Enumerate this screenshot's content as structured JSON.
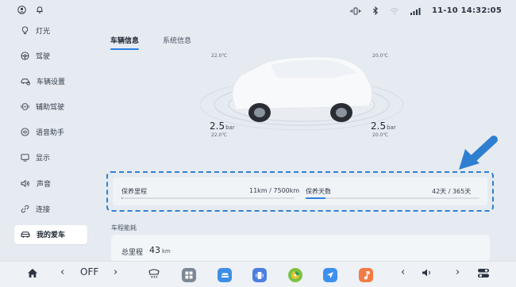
{
  "status_bar": {
    "datetime": "11-10 14:32:05",
    "left_icons": [
      "profile-icon",
      "bell-icon"
    ],
    "right_icons": [
      "vibrate-icon",
      "bluetooth-icon",
      "wifi-icon",
      "signal-icon"
    ]
  },
  "sidebar": {
    "items": [
      {
        "label": "灯光",
        "icon": "bulb-icon",
        "active": false
      },
      {
        "label": "驾驶",
        "icon": "steering-icon",
        "active": false
      },
      {
        "label": "车辆设置",
        "icon": "car-settings-icon",
        "active": false
      },
      {
        "label": "辅助驾驶",
        "icon": "assist-icon",
        "active": false
      },
      {
        "label": "语音助手",
        "icon": "voice-icon",
        "active": false
      },
      {
        "label": "显示",
        "icon": "display-icon",
        "active": false
      },
      {
        "label": "声音",
        "icon": "speaker-icon",
        "active": false
      },
      {
        "label": "连接",
        "icon": "link-icon",
        "active": false
      },
      {
        "label": "我的爱车",
        "icon": "car-icon",
        "active": true
      }
    ]
  },
  "tabs": [
    {
      "label": "车辆信息",
      "active": true
    },
    {
      "label": "系统信息",
      "active": false
    }
  ],
  "tires": {
    "front_left": {
      "temp": "22.0℃"
    },
    "front_right": {
      "temp": "20.0℃"
    },
    "rear_left": {
      "pressure": "2.5",
      "unit": "bar",
      "temp": "22.0℃"
    },
    "rear_right": {
      "pressure": "2.5",
      "unit": "bar",
      "temp": "20.0℃"
    }
  },
  "maintenance": {
    "mileage": {
      "label": "保养里程",
      "value": "11km / 7500km",
      "progress": 0.0015
    },
    "days": {
      "label": "保养天数",
      "value": "42天 / 365天",
      "progress": 0.115
    }
  },
  "energy": {
    "section_title": "车程能耗",
    "odometer_label": "总里程",
    "odometer_value": "43",
    "odometer_unit": "km"
  },
  "dock": {
    "climate_text": "OFF",
    "icons": [
      "home-icon",
      "chevron-left-icon",
      "chevron-right-icon",
      "defrost-icon",
      "apps-icon",
      "car-app-icon",
      "phone-app-icon",
      "maps-app-icon",
      "nav-app-icon",
      "music-app-icon",
      "volume-icon",
      "toggle-settings-icon"
    ]
  },
  "colors": {
    "accent": "#2b7fe0",
    "highlight_border": "#2f80d0",
    "arrow": "#2f7fd1"
  }
}
